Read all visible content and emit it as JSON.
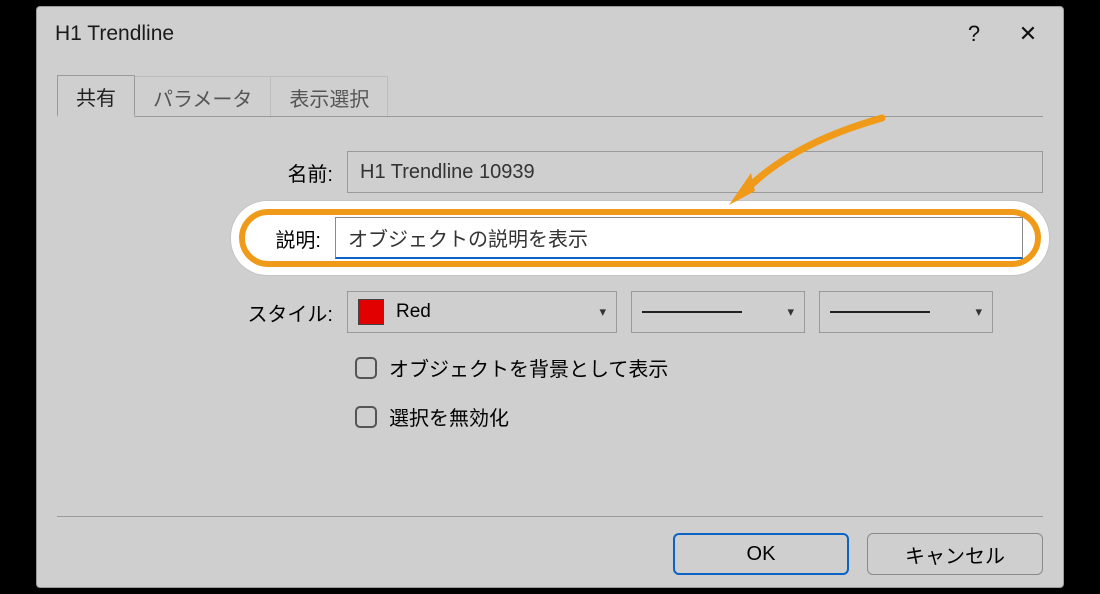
{
  "title": "H1 Trendline",
  "help": "?",
  "close": "✕",
  "tabs": {
    "t0": "共有",
    "t1": "パラメータ",
    "t2": "表示選択"
  },
  "labels": {
    "name": "名前:",
    "desc": "説明:",
    "style": "スタイル:"
  },
  "fields": {
    "name_value": "H1 Trendline 10939",
    "desc_value": "オブジェクトの説明を表示",
    "color_name": "Red"
  },
  "checks": {
    "bg": "オブジェクトを背景として表示",
    "disable": "選択を無効化"
  },
  "buttons": {
    "ok": "OK",
    "cancel": "キャンセル"
  }
}
